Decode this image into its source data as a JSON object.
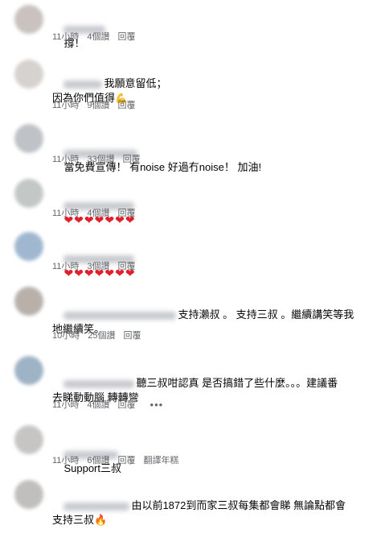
{
  "comments": [
    {
      "text": "撐！",
      "time": "11小時",
      "likes": "4個讚",
      "reply": "回覆"
    },
    {
      "text": "我願意留低；\n因為你們值得",
      "emoji": "💪",
      "time": "11小時",
      "likes": "9個讚",
      "reply": "回覆"
    },
    {
      "text": "當免費宣傳！ 有noise 好過冇noise！ 加油!",
      "time": "11小時",
      "likes": "33個讚",
      "reply": "回覆"
    },
    {
      "text": "",
      "hearts": "❤❤❤❤❤❤❤",
      "time": "11小時",
      "likes": "4個讚",
      "reply": "回覆"
    },
    {
      "text": "",
      "hearts": "❤❤❤❤❤❤❤",
      "time": "11小時",
      "likes": "3個讚",
      "reply": "回覆"
    },
    {
      "text": "支持瀨叔 。 支持三叔 。繼續講笑等我\n地繼續笑。",
      "time": "10小時",
      "likes": "25個讚",
      "reply": "回覆"
    },
    {
      "text": "聽三叔咁認真 是否搞錯了些什麼。。。建議番\n去睇動動腦 轉轉彎",
      "time": "11小時",
      "likes": "4個讚",
      "reply": "回覆",
      "more": "•••"
    },
    {
      "text": "Support三叔",
      "time": "11小時",
      "likes": "6個讚",
      "reply": "回覆",
      "translate": "翻譯年糕"
    },
    {
      "text": "由以前1872到而家三叔每集都會睇 無論點都會\n支持三叔",
      "emoji": "🔥"
    }
  ],
  "colors": {
    "meta": "#65676b",
    "heart": "#e0202b"
  }
}
